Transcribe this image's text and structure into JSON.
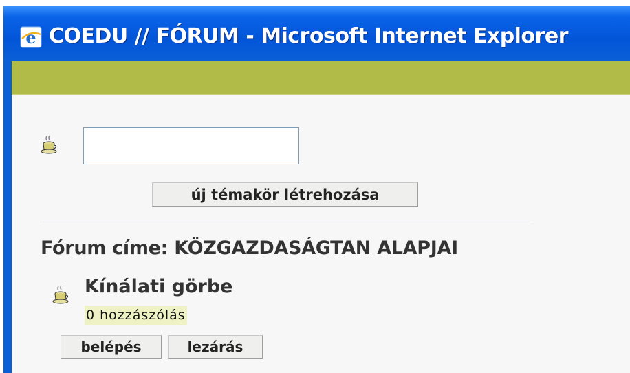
{
  "window": {
    "title": "COEDU // FÓRUM - Microsoft Internet Explorer",
    "icon": "internet-explorer-icon"
  },
  "colors": {
    "title_bar": "#0a5fd6",
    "olive_bar": "#b1bc48",
    "page_background": "#f7f7f8",
    "count_highlight": "#eef2c4"
  },
  "new_topic": {
    "icon": "coffee-cup-icon",
    "input_value": "",
    "button_label": "új témakör létrehozása"
  },
  "forum": {
    "title": "Fórum címe: KÖZGAZDASÁGTAN ALAPJAI",
    "topics": [
      {
        "icon": "coffee-cup-icon",
        "title": "Kínálati görbe",
        "post_count": "0 hozzászólás",
        "enter_label": "belépés",
        "close_label": "lezárás"
      }
    ]
  }
}
